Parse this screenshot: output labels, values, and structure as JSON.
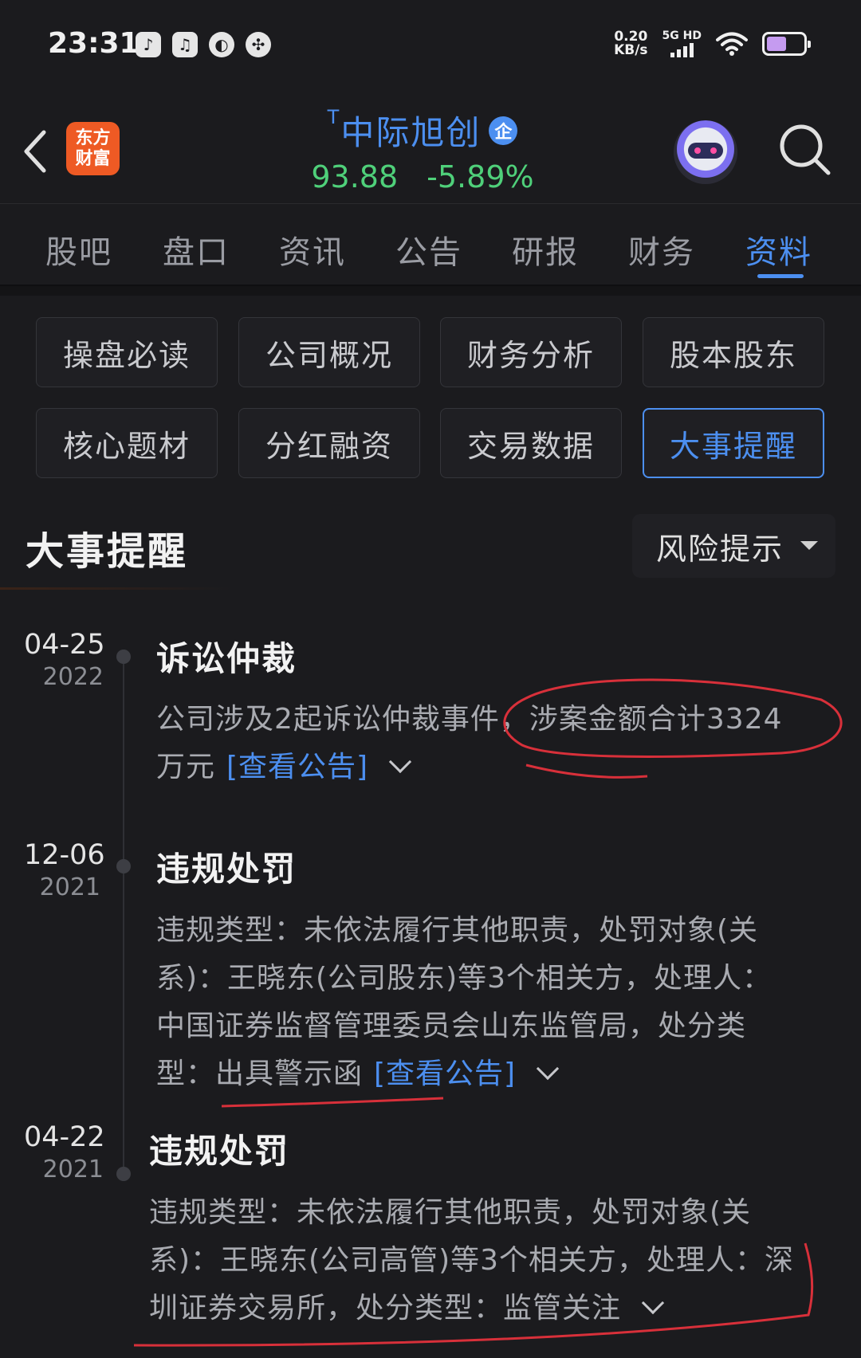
{
  "status_bar": {
    "time": "23:31",
    "net_speed_value": "0.20",
    "net_speed_unit": "KB/s",
    "network_type": "5G HD",
    "app_icons": [
      "app-notification-icon",
      "tiktok-icon",
      "planet-app-icon",
      "fan-app-icon"
    ]
  },
  "header": {
    "logo_line1": "东方",
    "logo_line2": "财富",
    "t_mark": "T",
    "stock_name": "中际旭创",
    "badge": "企",
    "price": "93.88",
    "change_pct": "-5.89%",
    "colors": {
      "accent": "#4c8ff0",
      "down": "#4fd07a",
      "brand": "#ee5a24"
    }
  },
  "tabs": [
    "股吧",
    "盘口",
    "资讯",
    "公告",
    "研报",
    "财务",
    "资料"
  ],
  "active_tab": "资料",
  "sub_nav": [
    "操盘必读",
    "公司概况",
    "财务分析",
    "股本股东",
    "核心题材",
    "分红融资",
    "交易数据",
    "大事提醒"
  ],
  "active_sub_nav": "大事提醒",
  "section": {
    "title": "大事提醒",
    "filter_label": "风险提示"
  },
  "events": [
    {
      "date": "04-25",
      "year": "2022",
      "title": "诉讼仲裁",
      "line1": "公司涉及2起诉讼仲裁事件，涉案金额合计3324",
      "line2": "万元",
      "link": "[查看公告]"
    },
    {
      "date": "12-06",
      "year": "2021",
      "title": "违规处罚",
      "line1": "违规类型：未依法履行其他职责，处罚对象(关",
      "line2": "系)：王晓东(公司股东)等3个相关方，处理人：",
      "line3": "中国证券监督管理委员会山东监管局，处分类",
      "line4": "型：出具警示函",
      "link": "[查看公告]"
    },
    {
      "date": "04-22",
      "year": "2021",
      "title": "违规处罚",
      "line1": "违规类型：未依法履行其他职责，处罚对象(关",
      "line2": "系)：王晓东(公司高管)等3个相关方，处理人：深",
      "line3": "圳证券交易所，处分类型：监管关注"
    }
  ]
}
